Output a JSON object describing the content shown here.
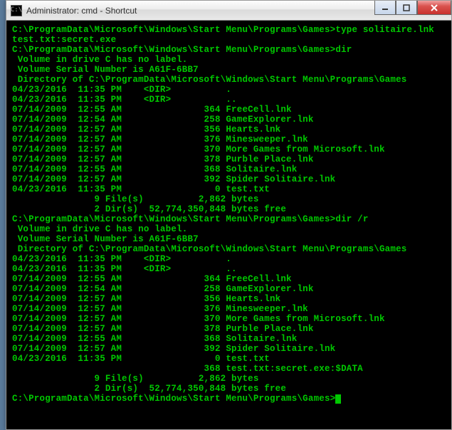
{
  "window": {
    "title": "Administrator: cmd - Shortcut",
    "app_icon_text": "C:\\"
  },
  "prompt_path": "C:\\ProgramData\\Microsoft\\Windows\\Start Menu\\Programs\\Games>",
  "cmd1_part1": "type solitaire.lnk",
  "cmd1_part2": "test.txt:secret.exe",
  "cmd2": "dir",
  "cmd3": "dir /r",
  "vol_line1": " Volume in drive C has no label.",
  "vol_line2": " Volume Serial Number is A61F-6BB7",
  "dir_header": " Directory of C:\\ProgramData\\Microsoft\\Windows\\Start Menu\\Programs\\Games",
  "listing1": [
    "04/23/2016  11:35 PM    <DIR>          .",
    "04/23/2016  11:35 PM    <DIR>          ..",
    "07/14/2009  12:55 AM               364 FreeCell.lnk",
    "07/14/2009  12:54 AM               258 GameExplorer.lnk",
    "07/14/2009  12:57 AM               356 Hearts.lnk",
    "07/14/2009  12:57 AM               376 Minesweeper.lnk",
    "07/14/2009  12:57 AM               370 More Games from Microsoft.lnk",
    "07/14/2009  12:57 AM               378 Purble Place.lnk",
    "07/14/2009  12:55 AM               368 Solitaire.lnk",
    "07/14/2009  12:57 AM               392 Spider Solitaire.lnk",
    "04/23/2016  11:35 PM                 0 test.txt",
    "               9 File(s)          2,862 bytes",
    "               2 Dir(s)  52,774,350,848 bytes free"
  ],
  "listing2": [
    "04/23/2016  11:35 PM    <DIR>          .",
    "04/23/2016  11:35 PM    <DIR>          ..",
    "07/14/2009  12:55 AM               364 FreeCell.lnk",
    "07/14/2009  12:54 AM               258 GameExplorer.lnk",
    "07/14/2009  12:57 AM               356 Hearts.lnk",
    "07/14/2009  12:57 AM               376 Minesweeper.lnk",
    "07/14/2009  12:57 AM               370 More Games from Microsoft.lnk",
    "07/14/2009  12:57 AM               378 Purble Place.lnk",
    "07/14/2009  12:55 AM               368 Solitaire.lnk",
    "07/14/2009  12:57 AM               392 Spider Solitaire.lnk",
    "04/23/2016  11:35 PM                 0 test.txt",
    "                                   368 test.txt:secret.exe:$DATA",
    "               9 File(s)          2,862 bytes",
    "               2 Dir(s)  52,774,350,848 bytes free"
  ]
}
